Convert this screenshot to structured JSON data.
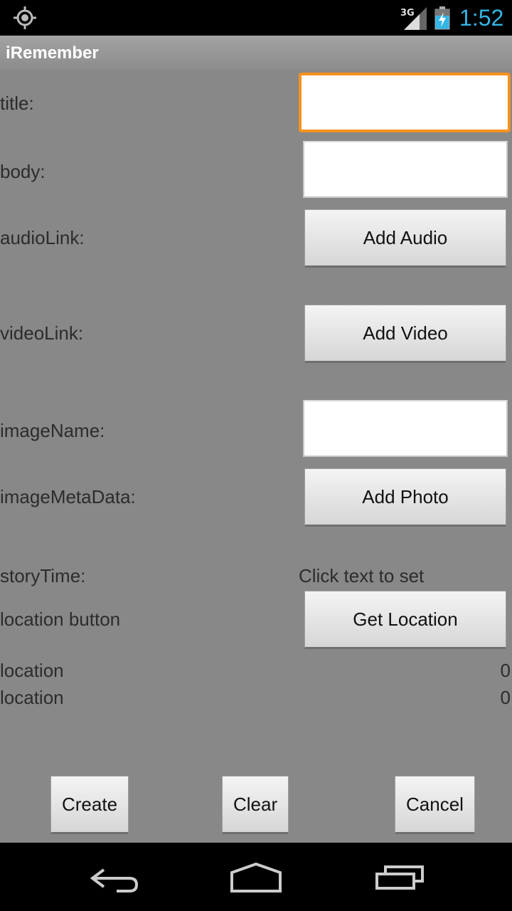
{
  "status_bar": {
    "network": "3G",
    "time": "1:52",
    "icons": [
      "gps-icon",
      "signal-icon",
      "battery-icon"
    ]
  },
  "app": {
    "title": "iRemember"
  },
  "form": {
    "title_label": "title:",
    "title_value": "",
    "body_label": "body:",
    "body_value": "",
    "audio_label": "audioLink:",
    "audio_button": "Add Audio",
    "video_label": "videoLink:",
    "video_button": "Add Video",
    "image_name_label": "imageName:",
    "image_name_value": "",
    "image_meta_label": "imageMetaData:",
    "image_meta_button": "Add Photo",
    "story_time_label": "storyTime:",
    "story_time_value": "Click text to set",
    "location_button_label": "location button",
    "location_button": "Get Location",
    "location1_label": "location",
    "location1_value": "0",
    "location2_label": "location",
    "location2_value": "0"
  },
  "actions": {
    "create": "Create",
    "clear": "Clear",
    "cancel": "Cancel"
  },
  "nav": {
    "icons": [
      "back-icon",
      "home-icon",
      "recents-icon"
    ]
  },
  "colors": {
    "accent": "#33b5e5",
    "focus": "#f6921e",
    "background": "#888888"
  }
}
